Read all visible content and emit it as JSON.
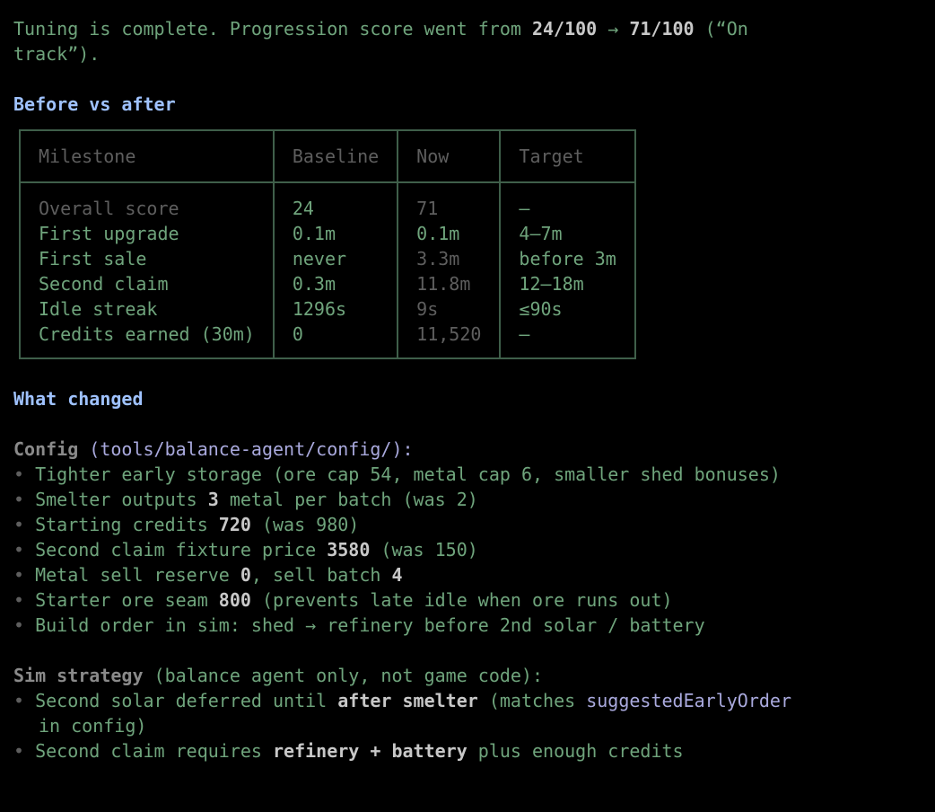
{
  "summary": {
    "line1_pre": "Tuning is complete. Progression score went from ",
    "from_score": "24/100",
    "arrow": " → ",
    "to_score": "71/100",
    "line1_post": " (“On",
    "line2": "track”)."
  },
  "section_before_after": "Before vs after",
  "table": {
    "headers": [
      "Milestone",
      "Baseline",
      "Now",
      "Target"
    ],
    "rows": [
      {
        "milestone": "Overall score",
        "baseline": "24",
        "now": "71",
        "target": "—"
      },
      {
        "milestone": "First upgrade",
        "baseline": "0.1m",
        "now": "0.1m",
        "target": "4–7m"
      },
      {
        "milestone": "First sale",
        "baseline": "never",
        "now": "3.3m",
        "target": "before 3m"
      },
      {
        "milestone": "Second claim",
        "baseline": "0.3m",
        "now": "11.8m",
        "target": "12–18m"
      },
      {
        "milestone": "Idle streak",
        "baseline": "1296s",
        "now": "9s",
        "target": "≤90s"
      },
      {
        "milestone": "Credits earned (30m)",
        "baseline": "0",
        "now": "11,520",
        "target": "—"
      }
    ]
  },
  "section_what_changed": "What changed",
  "config": {
    "label": "Config",
    "path_open": " (",
    "path": "tools/balance-agent/config/",
    "path_close": "):",
    "bullets": [
      {
        "pre": "Tighter early storage (ore cap 54, metal cap 6, smaller shed bonuses)",
        "bold": "",
        "post": ""
      },
      {
        "pre": "Smelter outputs ",
        "bold": "3",
        "post": " metal per batch (was 2)"
      },
      {
        "pre": "Starting credits ",
        "bold": "720",
        "post": " (was 980)"
      },
      {
        "pre": "Second claim fixture price ",
        "bold": "3580",
        "post": " (was 150)"
      },
      {
        "pre": "Metal sell reserve ",
        "bold": "0",
        "post": ", sell batch ",
        "bold2": "4"
      },
      {
        "pre": "Starter ore seam ",
        "bold": "800",
        "post": " (prevents late idle when ore runs out)"
      },
      {
        "pre": "Build order in sim: shed → refinery before 2nd solar / battery",
        "bold": "",
        "post": ""
      }
    ]
  },
  "sim": {
    "label": "Sim strategy",
    "note": " (balance agent only, not game code):",
    "bullet1": {
      "pre": "Second solar deferred until ",
      "bold": "after smelter",
      "mid": " (matches ",
      "code": "suggestedEarlyOrder",
      "cont": "in config)"
    },
    "bullet2": {
      "pre": "Second claim requires ",
      "bold": "refinery + battery",
      "post": " plus enough credits"
    }
  },
  "bullet_glyph": "• "
}
